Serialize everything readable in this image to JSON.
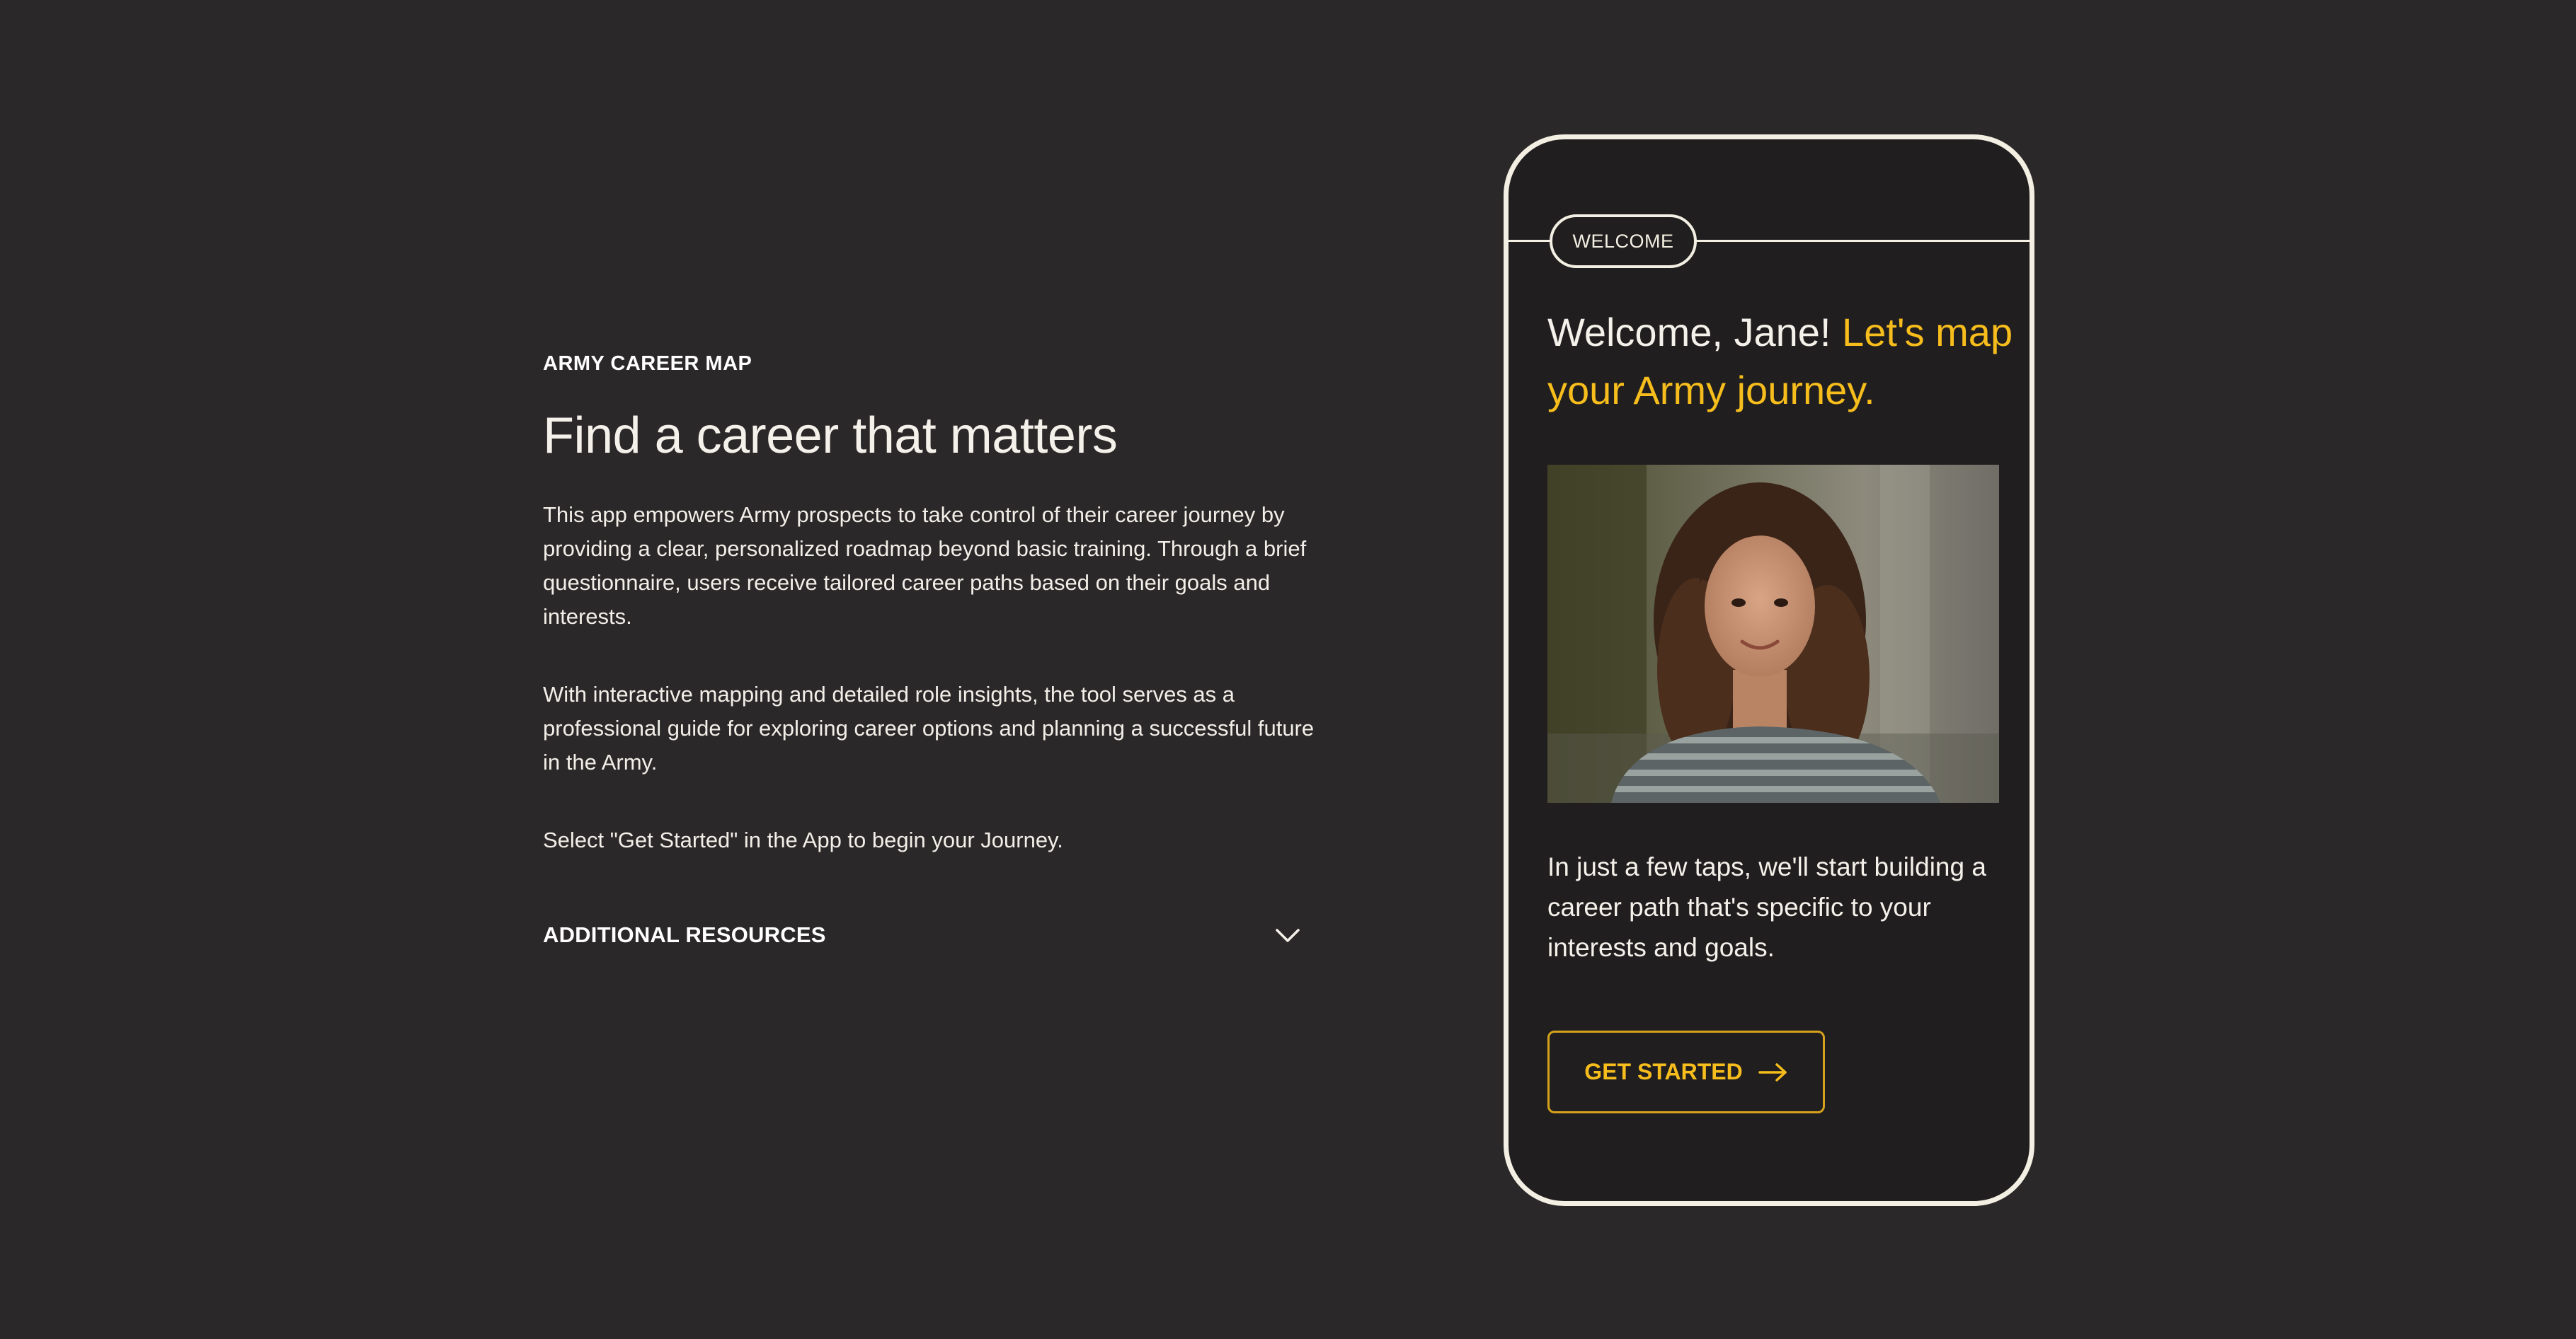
{
  "intro": {
    "eyebrow": "ARMY CAREER MAP",
    "headline": "Find a career that matters",
    "paragraphs": [
      "This app empowers Army prospects to take control of their career journey by providing a clear, personalized roadmap beyond basic training. Through a brief questionnaire, users receive tailored career paths based on their goals and interests.",
      "With interactive mapping and detailed role insights, the tool serves as a professional guide for exploring career options and planning a successful future in the Army.",
      "Select \"Get Started\" in the App to begin your Journey."
    ],
    "resources_label": "ADDITIONAL RESOURCES",
    "resources_icon": "chevron-down-icon"
  },
  "phone": {
    "badge": "WELCOME",
    "greeting_plain": "Welcome, Jane! ",
    "greeting_accent": "Let's map your Army journey.",
    "body": "In just a few taps, we'll start building a career path that's specific to your interests and goals.",
    "cta_label": "GET STARTED",
    "cta_icon": "arrow-right-icon"
  },
  "colors": {
    "background": "#2a2829",
    "phone_background": "#201e1f",
    "phone_frame": "#f3efe2",
    "accent": "#f6bd1c",
    "text": "#f4f1ea"
  }
}
